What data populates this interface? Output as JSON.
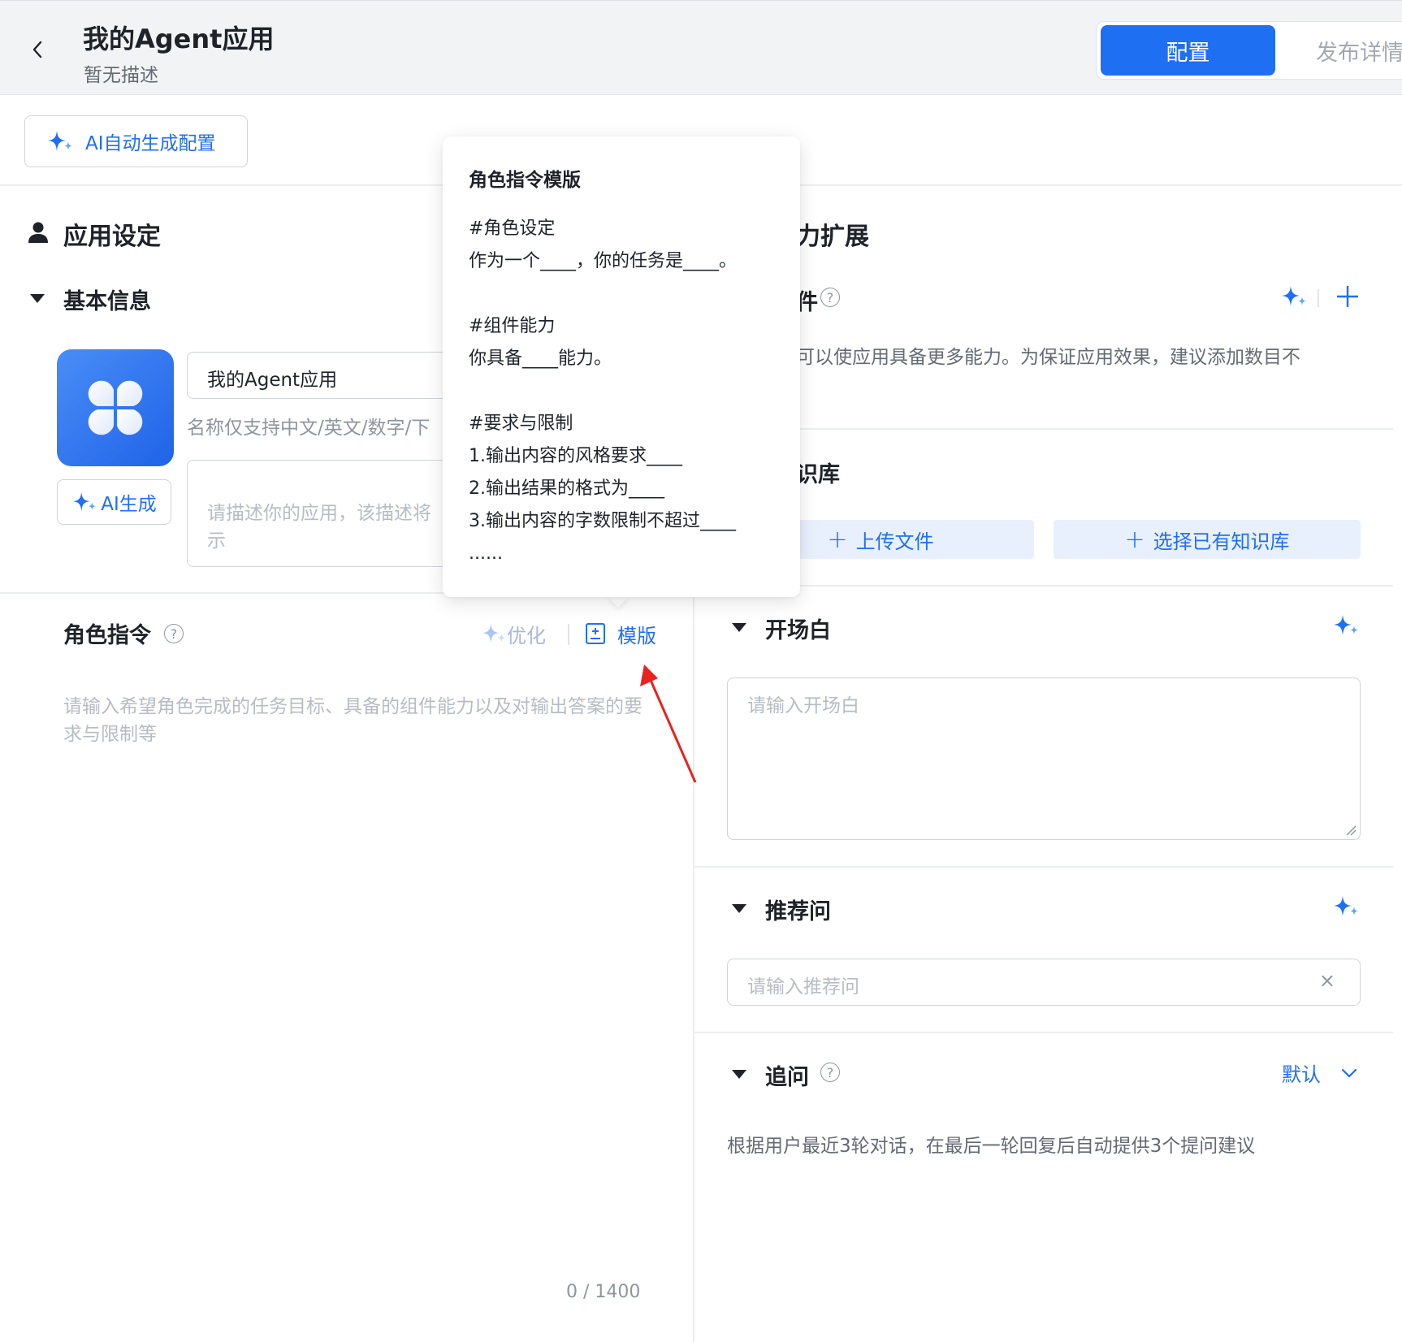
{
  "header": {
    "title": "我的Agent应用",
    "description": "暂无描述",
    "tabs": [
      {
        "label": "配置",
        "active": true
      },
      {
        "label": "发布详情",
        "active": false
      }
    ]
  },
  "toolbar": {
    "ai_auto_config_label": "AI自动生成配置"
  },
  "app_settings": {
    "title": "应用设定",
    "basic_info": {
      "title": "基本信息",
      "icon": "clover-app-icon",
      "ai_generate_label": "AI生成",
      "name_value": "我的Agent应用",
      "name_hint": "名称仅支持中文/英文/数字/下",
      "desc_placeholder": "请描述你的应用，该描述将\n示"
    },
    "role_instruction": {
      "title": "角色指令",
      "optimize_label": "优化",
      "template_label": "模版",
      "placeholder": "请输入希望角色完成的任务目标、具备的组件能力以及对输出答案的要求与限制等",
      "char_count": "0 / 1400"
    }
  },
  "popover": {
    "title": "角色指令模版",
    "lines": [
      "#角色设定",
      "作为一个____，你的任务是____。",
      "",
      "#组件能力",
      "你具备____能力。",
      "",
      "#要求与限制",
      "1.输出内容的风格要求____",
      "2.输出结果的格式为____",
      "3.输出内容的字数限制不超过____",
      "......"
    ]
  },
  "capability_extension": {
    "title": "力扩展",
    "plugin": {
      "title": "件",
      "description": "可以使应用具备更多能力。为保证应用效果，建议添加数目不"
    },
    "knowledge": {
      "title": "识库",
      "upload_label": "上传文件",
      "select_label": "选择已有知识库"
    },
    "opening": {
      "title": "开场白",
      "placeholder": "请输入开场白"
    },
    "recommended_questions": {
      "title": "推荐问",
      "placeholder": "请输入推荐问"
    },
    "follow_up": {
      "title": "追问",
      "select_value": "默认",
      "description": "根据用户最近3轮对话，在最后一轮回复后自动提供3个提问建议"
    }
  },
  "colors": {
    "primary": "#1f6ff2",
    "header_bg": "#f2f3f5",
    "annotation_arrow": "#e8231f"
  }
}
